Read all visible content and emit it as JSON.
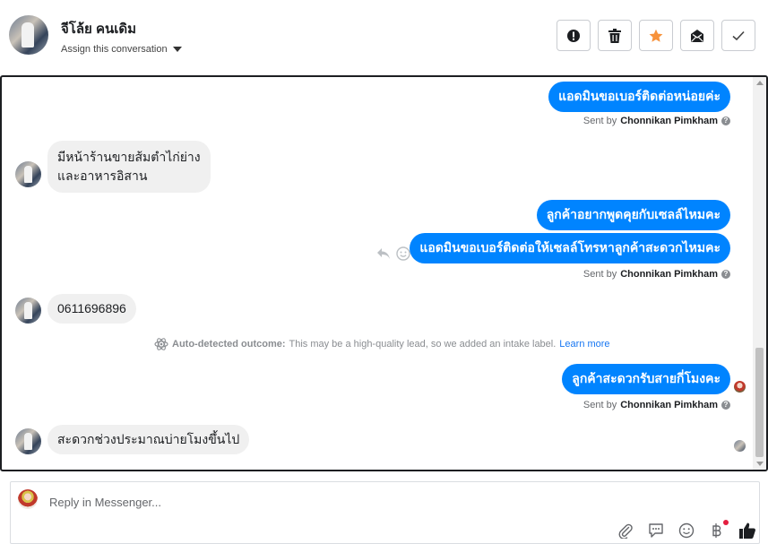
{
  "header": {
    "contact_name": "จีโล้ย คนเดิม",
    "assign_label": "Assign this conversation",
    "actions": [
      {
        "name": "mark-spam-button",
        "icon": "alert-circle-icon",
        "color": "#1c1e21"
      },
      {
        "name": "delete-button",
        "icon": "trash-icon",
        "color": "#1c1e21"
      },
      {
        "name": "star-button",
        "icon": "star-icon",
        "color": "#f7923b"
      },
      {
        "name": "mark-unread-button",
        "icon": "envelope-icon",
        "color": "#1c1e21"
      },
      {
        "name": "mark-done-button",
        "icon": "check-icon",
        "color": "#1c1e21"
      }
    ]
  },
  "conversation": {
    "messages": [
      {
        "direction": "out",
        "text": "แอดมินขอเบอร์ติดต่อหน่อยค่ะ"
      },
      {
        "direction": "in",
        "lines": [
          "มีหน้าร้านขายส้มตำไก่ย่าง",
          "และอาหารอิสาน"
        ]
      },
      {
        "direction": "out",
        "text": "ลูกค้าอยากพูดคุยกับเซลล์ไหมคะ"
      },
      {
        "direction": "out",
        "text": "แอดมินขอเบอร์ติดต่อให้เซลล์โทรหาลูกค้าสะดวกไหมคะ"
      },
      {
        "direction": "in",
        "text": "0611696896"
      },
      {
        "direction": "out",
        "text": "ลูกค้าสะดวกรับสายกี่โมงคะ"
      },
      {
        "direction": "in",
        "text": "สะดวกช่วงประมาณบ่ายโมงขึ้นไป"
      }
    ],
    "sent_by_prefix": "Sent by",
    "sent_by_name": "Chonnikan Pimkham",
    "outcome": {
      "label": "Auto-detected outcome:",
      "text": "This may be a high-quality lead, so we added an intake label.",
      "link": "Learn more"
    },
    "accent_color": "#0084ff"
  },
  "composer": {
    "placeholder": "Reply in Messenger...",
    "tools": [
      "paperclip-icon",
      "chat-bubble-icon",
      "smiley-icon",
      "baht-icon",
      "thumbs-up-icon"
    ]
  }
}
